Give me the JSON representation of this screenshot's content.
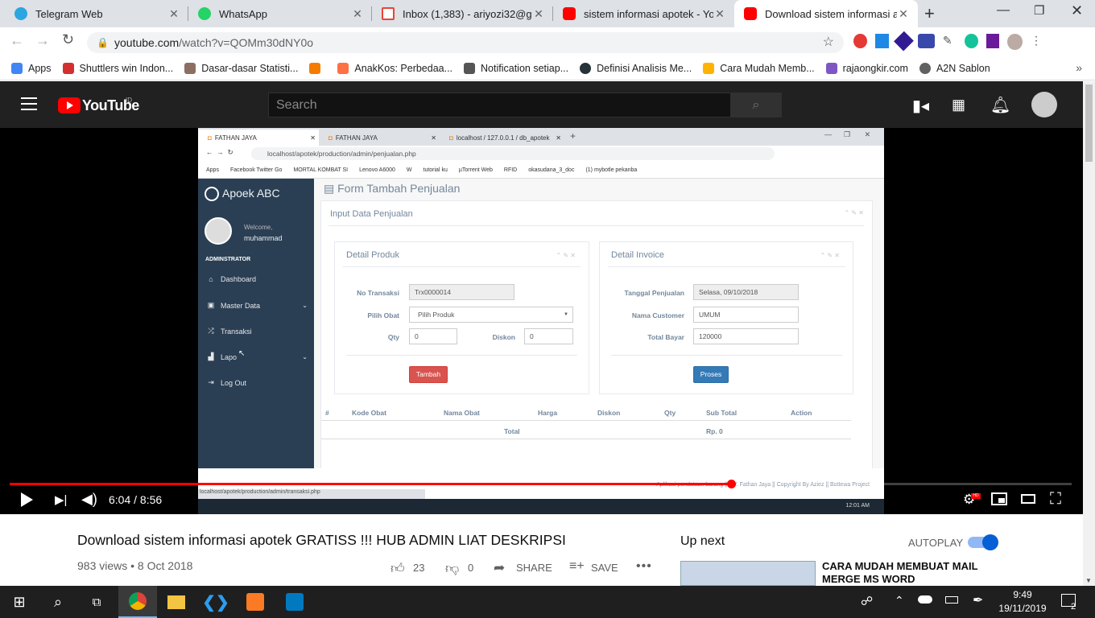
{
  "tabs": [
    {
      "title": "Telegram Web",
      "color": "#2ca5e0"
    },
    {
      "title": "WhatsApp",
      "color": "#25d366"
    },
    {
      "title": "Inbox (1,383) - ariyozi32@gma",
      "color": "#ea4335"
    },
    {
      "title": "sistem informasi apotek - YouT",
      "color": "#ff0000"
    },
    {
      "title": "Download sistem informasi ap",
      "color": "#ff0000"
    }
  ],
  "new_tab": "+",
  "url": {
    "host": "youtube.com",
    "path": "/watch?v=QOMm30dNY0o"
  },
  "bookmarks": [
    {
      "label": "Apps",
      "color": "#4285f4"
    },
    {
      "label": "Shuttlers win Indon...",
      "color": "#d32f2f"
    },
    {
      "label": "Dasar-dasar Statisti...",
      "color": "#8d6e63"
    },
    {
      "label": "",
      "color": "#f57c00"
    },
    {
      "label": "AnakKos: Perbedaa...",
      "color": "#ff7043"
    },
    {
      "label": "Notification setiap...",
      "color": "#555555"
    },
    {
      "label": "Definisi Analisis Me...",
      "color": "#263238"
    },
    {
      "label": "Cara Mudah Memb...",
      "color": "#ffb300"
    },
    {
      "label": "rajaongkir.com",
      "color": "#7e57c2"
    },
    {
      "label": "A2N Sablon",
      "color": "#616161"
    }
  ],
  "youtube": {
    "logo": "YouTube",
    "logo_sup": "ID",
    "search_placeholder": "Search"
  },
  "video": {
    "title": "Download sistem informasi apotek GRATISS !!! HUB ADMIN LIAT DESKRIPSI",
    "views": "983 views • 8 Oct 2018",
    "likes": "23",
    "dislikes": "0",
    "share": "SHARE",
    "save": "SAVE",
    "time": "6:04 / 8:56",
    "progress": 0.68
  },
  "up_next": {
    "label": "Up next",
    "autoplay": "AUTOPLAY",
    "first": "CARA MUDAH MEMBUAT MAIL MERGE MS WORD"
  },
  "inner": {
    "tabs": [
      "FATHAN JAYA",
      "FATHAN JAYA",
      "localhost / 127.0.0.1 / db_apotek"
    ],
    "url": "localhost/apotek/production/admin/penjualan.php",
    "bookmarks": [
      "Apps",
      "Facebook Twitter Go",
      "MORTAL KOMBAT SI",
      "Lenovo A6000",
      "W",
      "tutorial ku",
      "µTorrent Web",
      "RFID",
      "okasudana_3_doc",
      "(1) mybotle pekanba"
    ],
    "brand": "Apoek ABC",
    "welcome": "Welcome,",
    "user": "muhammad",
    "section": "ADMINSTRATOR",
    "nav": [
      "Dashboard",
      "Master Data",
      "Transaksi",
      "Lapo",
      "Log Out"
    ],
    "page_title": "Form Tambah Penjualan",
    "panel_title": "Input Data Penjualan",
    "detail_produk": "Detail Produk",
    "detail_invoice": "Detail Invoice",
    "no_transaksi_label": "No Transaksi",
    "no_transaksi": "Trx0000014",
    "pilih_obat_label": "Pilih Obat",
    "pilih_obat": "Pilih Produk",
    "qty_label": "Qty",
    "qty": "0",
    "diskon_label": "Diskon",
    "diskon": "0",
    "tanggal_label": "Tanggal Penjualan",
    "tanggal": "Selasa, 09/10/2018",
    "customer_label": "Nama Customer",
    "customer": "UMUM",
    "total_label": "Total Bayar",
    "total": "120000",
    "btn_tambah": "Tambah",
    "btn_proses": "Proses",
    "columns": [
      "#",
      "Kode Obat",
      "Nama Obat",
      "Harga",
      "Diskon",
      "Qty",
      "Sub Total",
      "Action"
    ],
    "total_row_label": "Total",
    "total_row_value": "Rp. 0",
    "footer": "Aplikasi pendataan barang || CV. Fathan Jaya || Copyright By Aziez || Bottewa Project",
    "status_url": "localhost/apotek/production/admin/transaksi.php",
    "clock": "12:01 AM"
  },
  "taskbar": {
    "time": "9:49",
    "date": "19/11/2019",
    "notif": "2"
  }
}
